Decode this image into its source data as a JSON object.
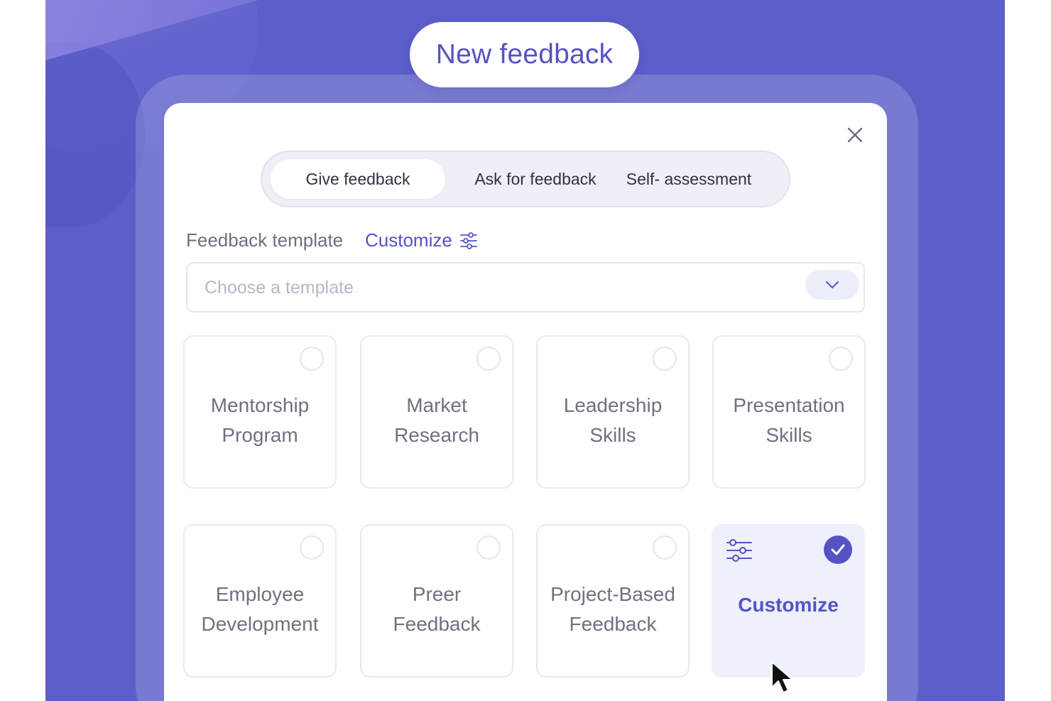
{
  "modal": {
    "title": "New feedback",
    "tabs": [
      {
        "label": "Give feedback",
        "active": true
      },
      {
        "label": "Ask for feedback",
        "active": false
      },
      {
        "label": "Self- assessment",
        "active": false
      }
    ],
    "template_label": "Feedback template",
    "customize_link": "Customize",
    "select_placeholder": "Choose a template",
    "templates": [
      {
        "line1": "Mentorship",
        "line2": "Program",
        "selected": false
      },
      {
        "line1": "Market",
        "line2": "Research",
        "selected": false
      },
      {
        "line1": "Leadership",
        "line2": "Skills",
        "selected": false
      },
      {
        "line1": "Presentation",
        "line2": "Skills",
        "selected": false
      },
      {
        "line1": "Employee",
        "line2": "Development",
        "selected": false
      },
      {
        "line1": "Preer",
        "line2": "Feedback",
        "selected": false
      },
      {
        "line1": "Project-Based",
        "line2": "Feedback",
        "selected": false
      }
    ],
    "custom_tile": {
      "label": "Customize",
      "selected": true
    }
  },
  "colors": {
    "background": "#5d5fc9",
    "accent": "#5553c4",
    "text_muted": "#6f7180",
    "custom_tile_bg": "#eef0fb"
  },
  "icons": {
    "close": "close-icon",
    "settings": "sliders-icon",
    "chevron": "chevron-down-icon",
    "check": "check-icon",
    "cursor": "mouse-pointer-icon"
  }
}
